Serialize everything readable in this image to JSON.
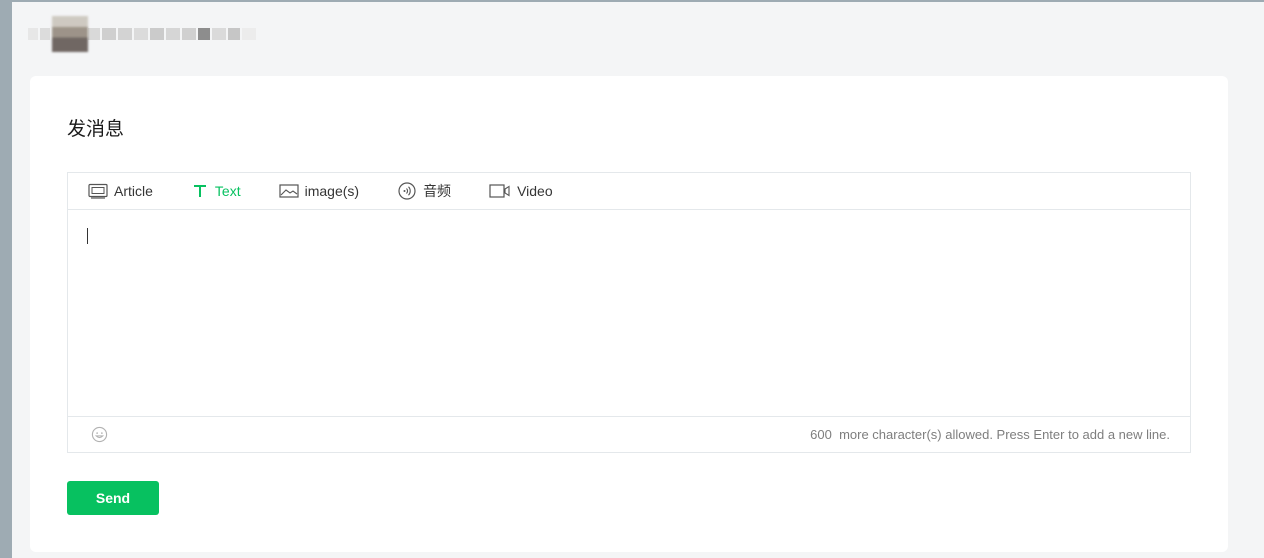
{
  "page": {
    "title": "发消息"
  },
  "editor": {
    "tabs": [
      {
        "label": "Article",
        "icon": "article-icon",
        "active": false
      },
      {
        "label": "Text",
        "icon": "text-icon",
        "active": true
      },
      {
        "label": "image(s)",
        "icon": "image-icon",
        "active": false
      },
      {
        "label": "音频",
        "icon": "audio-icon",
        "active": false
      },
      {
        "label": "Video",
        "icon": "video-icon",
        "active": false
      }
    ],
    "text_value": "",
    "counter_number": "600",
    "counter_text": "more character(s) allowed. Press Enter to add a new line."
  },
  "actions": {
    "send_label": "Send"
  },
  "colors": {
    "accent": "#07c160",
    "border": "#e4e8eb",
    "background": "#f4f5f6",
    "outer": "#9eabb3"
  }
}
